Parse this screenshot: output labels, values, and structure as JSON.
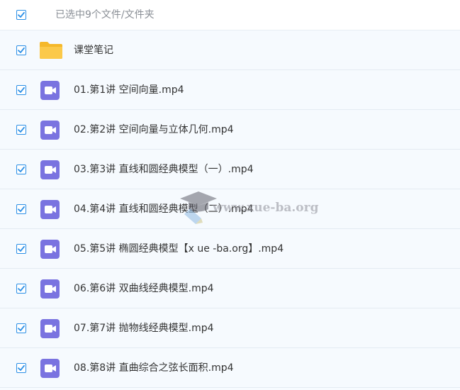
{
  "header": {
    "selection_text": "已选中9个文件/文件夹",
    "select_all_checked": true
  },
  "colors": {
    "checkbox_accent": "#2b8fe6",
    "video_icon": "#7a73e0",
    "folder_icon": "#f9c53e"
  },
  "items": [
    {
      "name": "课堂笔记",
      "type": "folder",
      "icon": "folder-icon",
      "checked": true
    },
    {
      "name": "01.第1讲 空间向量.mp4",
      "type": "video",
      "icon": "video-file-icon",
      "checked": true
    },
    {
      "name": "02.第2讲 空间向量与立体几何.mp4",
      "type": "video",
      "icon": "video-file-icon",
      "checked": true
    },
    {
      "name": "03.第3讲 直线和圆经典模型（一）.mp4",
      "type": "video",
      "icon": "video-file-icon",
      "checked": true
    },
    {
      "name": "04.第4讲 直线和圆经典模型（二）.mp4",
      "type": "video",
      "icon": "video-file-icon",
      "checked": true
    },
    {
      "name": "05.第5讲 椭圆经典模型【x ue -ba.org】.mp4",
      "type": "video",
      "icon": "video-file-icon",
      "checked": true
    },
    {
      "name": "06.第6讲 双曲线经典模型.mp4",
      "type": "video",
      "icon": "video-file-icon",
      "checked": true
    },
    {
      "name": "07.第7讲 抛物线经典模型.mp4",
      "type": "video",
      "icon": "video-file-icon",
      "checked": true
    },
    {
      "name": "08.第8讲 直曲综合之弦长面积.mp4",
      "type": "video",
      "icon": "video-file-icon",
      "checked": true
    }
  ],
  "watermark": {
    "text": "www.xue-ba.org",
    "icon": "graduation-cap-icon"
  }
}
